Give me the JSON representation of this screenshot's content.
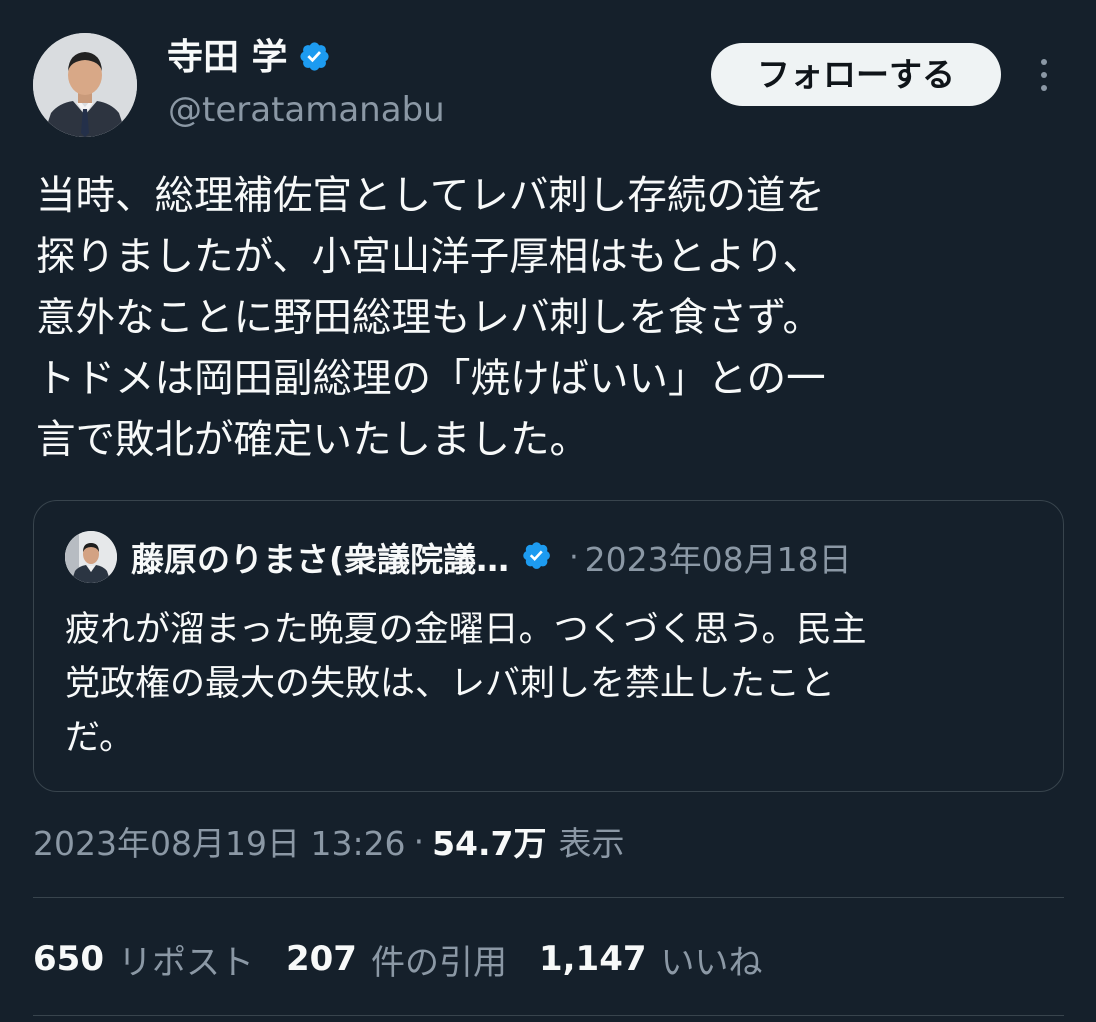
{
  "author": {
    "display_name": "寺田 学",
    "handle": "@teratamanabu"
  },
  "follow_button_label": "フォローする",
  "tweet_lines": [
    "当時、総理補佐官としてレバ刺し存続の道を",
    "探りましたが、小宮山洋子厚相はもとより、",
    "意外なことに野田総理もレバ刺しを食さず。",
    "トドメは岡田副総理の「焼けばいい」との一",
    "言で敗北が確定いたしました。"
  ],
  "quote": {
    "author_name": "藤原のりまさ(衆議院議…",
    "separator": "·",
    "date": "2023年08月18日",
    "text_lines": [
      "疲れが溜まった晩夏の金曜日。つくづく思う。民主",
      "党政権の最大の失敗は、レバ刺しを禁止したこと",
      "だ。"
    ]
  },
  "meta": {
    "timestamp": "2023年08月19日 13:26",
    "separator": "·",
    "views_count": "54.7万",
    "views_label": "表示"
  },
  "stats": [
    {
      "count": "650",
      "label": "リポスト"
    },
    {
      "count": "207",
      "label": "件の引用"
    },
    {
      "count": "1,147",
      "label": "いいね"
    }
  ],
  "colors": {
    "background": "#15202b",
    "verified": "#1d9bf0",
    "secondary_text": "#8b98a5",
    "border": "#38444d",
    "follow_button_bg": "#eff3f4"
  },
  "icons": {
    "verified": "verified-badge-icon",
    "more": "more-icon"
  }
}
